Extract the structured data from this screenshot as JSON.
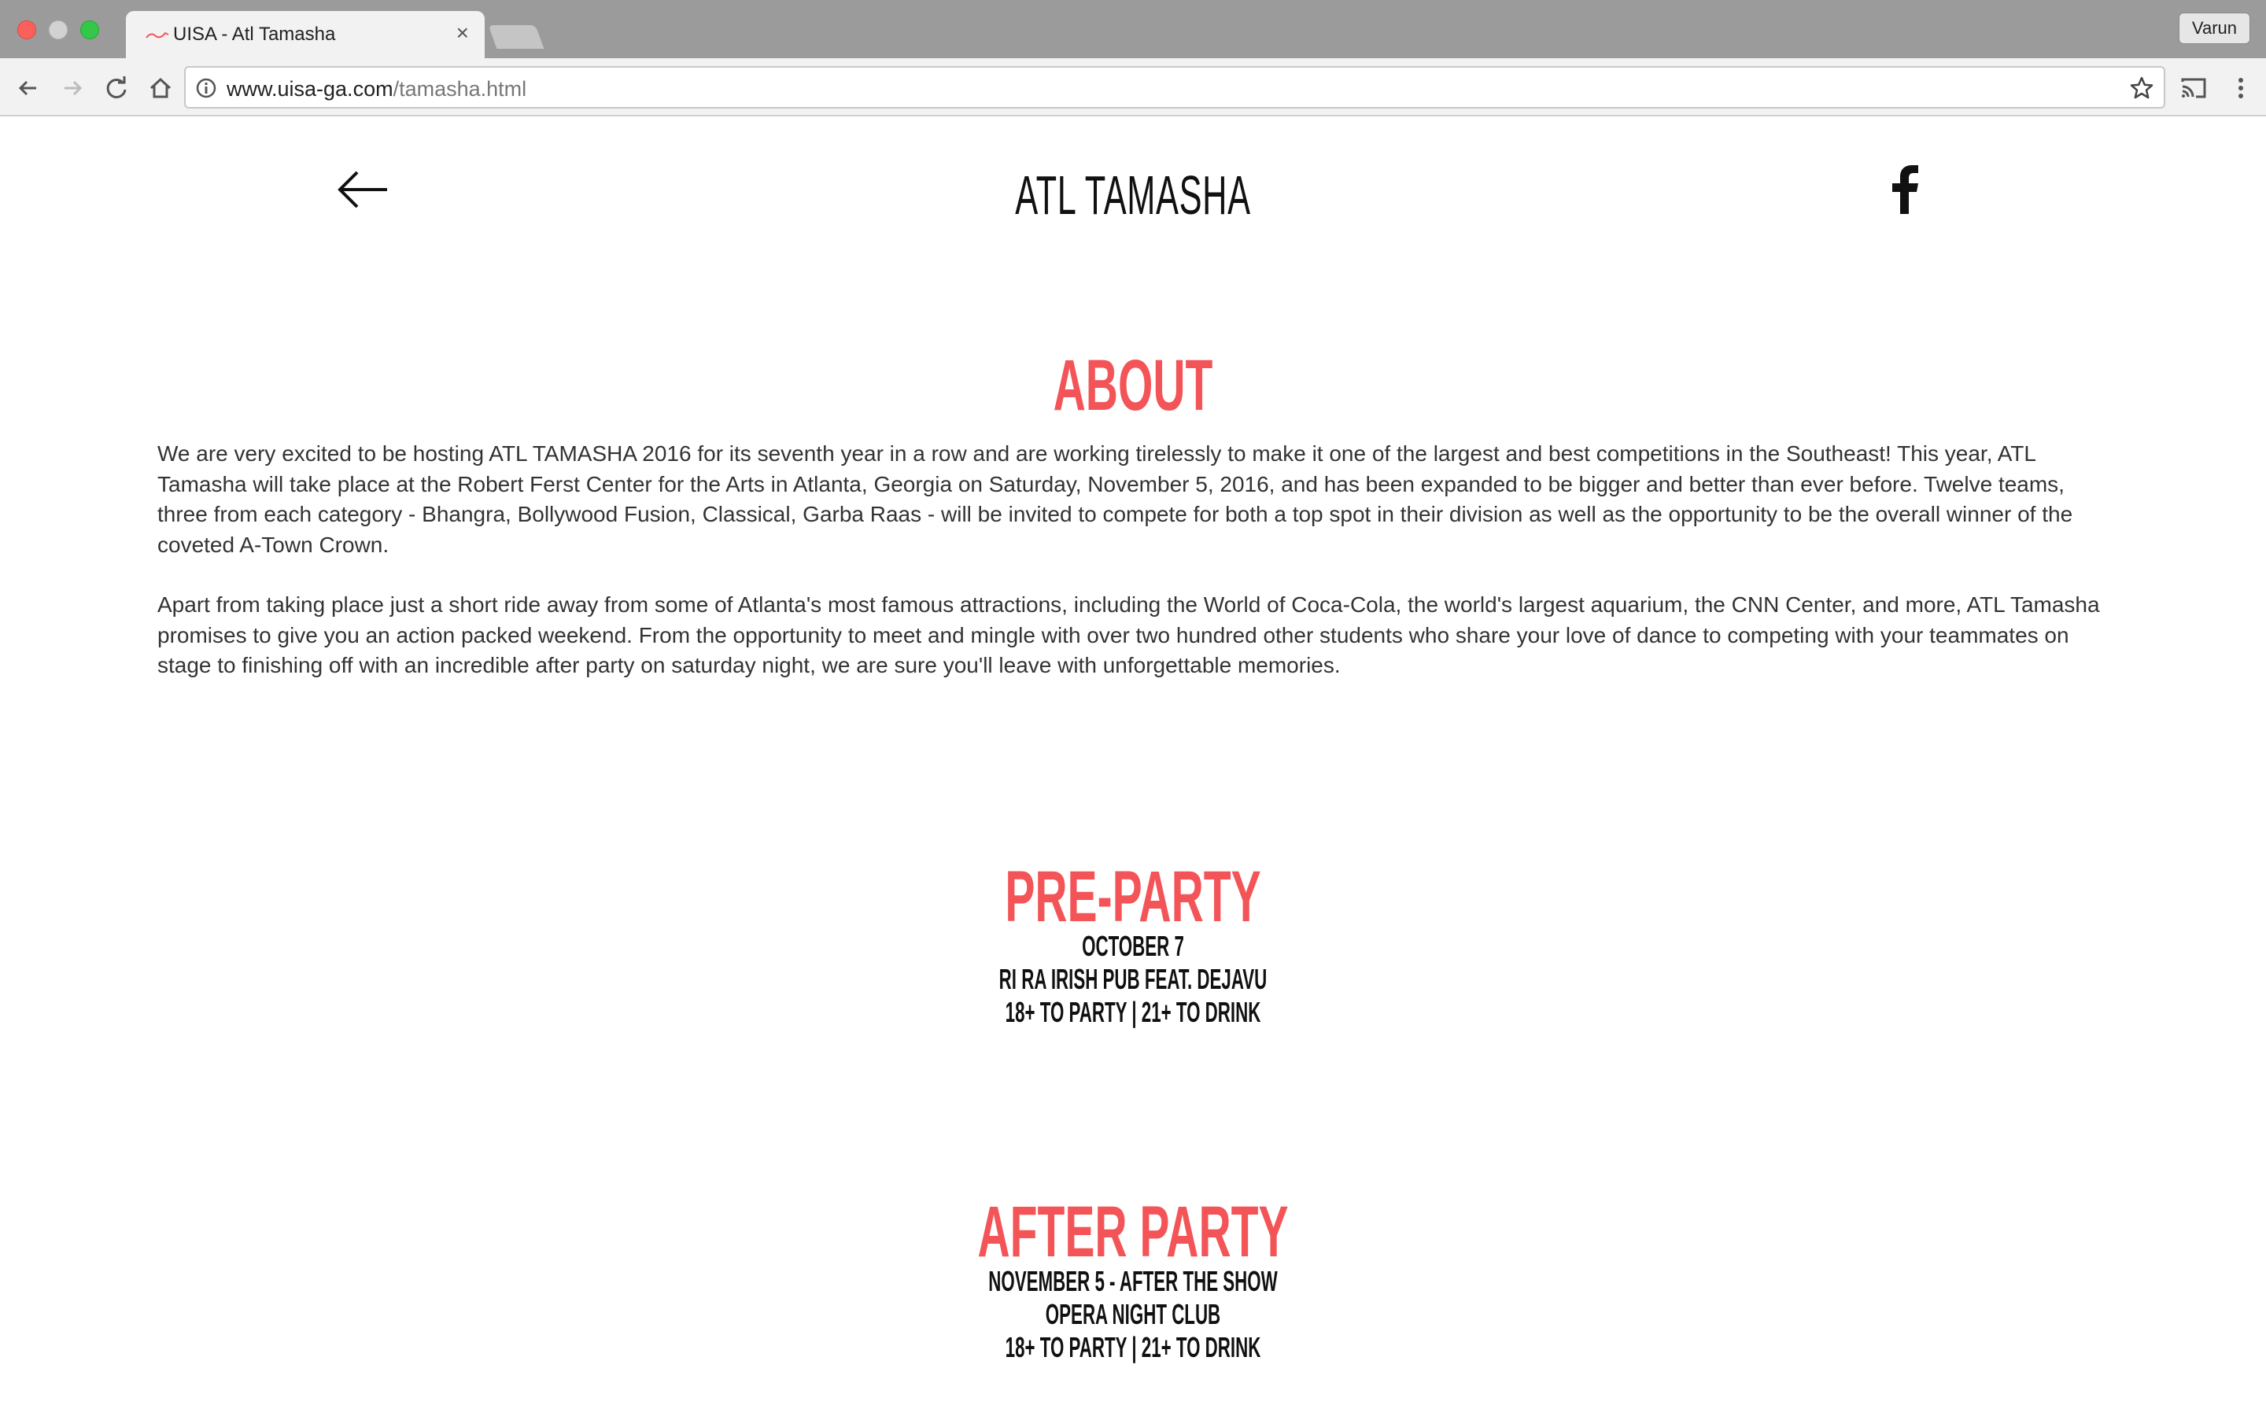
{
  "browser": {
    "tab": {
      "title": "UISA - Atl Tamasha",
      "close_glyph": "×"
    },
    "profile_name": "Varun",
    "url": {
      "domain": "www.uisa-ga.com",
      "path": "/tamasha.html"
    }
  },
  "header": {
    "title": "ATL TAMASHA"
  },
  "about": {
    "heading": "ABOUT",
    "paragraphs": [
      "We are very excited to be hosting ATL TAMASHA 2016 for its seventh year in a row and are working tirelessly to make it one of the largest and best competitions in the Southeast! This year, ATL Tamasha will take place at the Robert Ferst Center for the Arts in Atlanta, Georgia on Saturday, November 5, 2016, and has been expanded to be bigger and better than ever before. Twelve teams, three from each category - Bhangra, Bollywood Fusion, Classical, Garba Raas - will be invited to compete for both a top spot in their division as well as the opportunity to be the overall winner of the coveted A-Town Crown.",
      "Apart from taking place just a short ride away from some of Atlanta's most famous attractions, including the World of Coca-Cola, the world's largest aquarium, the CNN Center, and more, ATL Tamasha promises to give you an action packed weekend. From the opportunity to meet and mingle with over two hundred other students who share your love of dance to competing with your teammates on stage to finishing off with an incredible after party on saturday night, we are sure you'll leave with unforgettable memories."
    ]
  },
  "pre_party": {
    "heading": "PRE-PARTY",
    "lines": [
      "OCTOBER 7",
      "RI RA IRISH PUB FEAT. DEJAVU",
      "18+ TO PARTY | 21+ TO DRINK"
    ]
  },
  "after_party": {
    "heading": "AFTER PARTY",
    "lines": [
      "NOVEMBER 5 - AFTER THE SHOW",
      "OPERA NIGHT CLUB",
      "18+ TO PARTY | 21+ TO DRINK"
    ]
  },
  "colors": {
    "accent": "#f35457",
    "text": "#333333",
    "heading": "#111111"
  },
  "icons": [
    "back-arrow-icon",
    "facebook-icon",
    "reload-icon",
    "home-icon",
    "info-icon",
    "star-icon",
    "cast-icon",
    "menu-icon"
  ]
}
